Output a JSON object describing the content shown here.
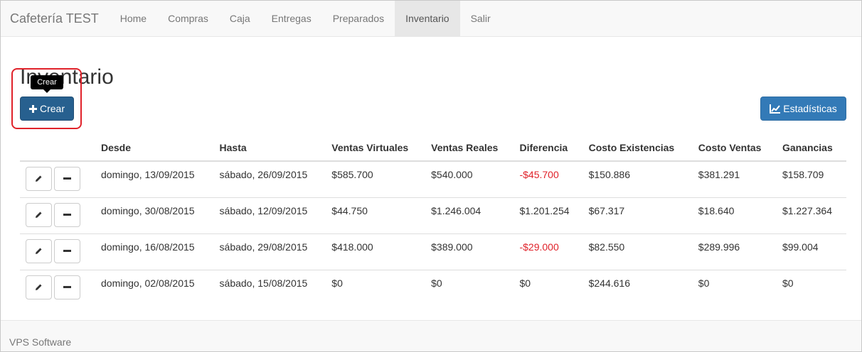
{
  "navbar": {
    "brand": "Cafetería TEST",
    "items": [
      {
        "label": "Home",
        "active": false
      },
      {
        "label": "Compras",
        "active": false
      },
      {
        "label": "Caja",
        "active": false
      },
      {
        "label": "Entregas",
        "active": false
      },
      {
        "label": "Preparados",
        "active": false
      },
      {
        "label": "Inventario",
        "active": true
      },
      {
        "label": "Salir",
        "active": false
      }
    ]
  },
  "page": {
    "title": "Inventario",
    "create_label": "Crear",
    "create_tooltip": "Crear",
    "stats_label": "Estadísticas",
    "create_icon": "plus-icon",
    "stats_icon": "line-chart-icon"
  },
  "colors": {
    "negative": "#e0222a",
    "primary": "#337ab7",
    "highlight": "#e0222a"
  },
  "table": {
    "headers": [
      "",
      "Desde",
      "Hasta",
      "Ventas Virtuales",
      "Ventas Reales",
      "Diferencia",
      "Costo Existencias",
      "Costo Ventas",
      "Ganancias"
    ],
    "row_actions": [
      "pencil-icon",
      "minus-icon"
    ],
    "rows": [
      {
        "desde": "domingo, 13/09/2015",
        "hasta": "sábado, 26/09/2015",
        "virtuales": "$585.700",
        "reales": "$540.000",
        "diferencia": "-$45.700",
        "neg": true,
        "existencias": "$150.886",
        "costo_ventas": "$381.291",
        "ganancias": "$158.709"
      },
      {
        "desde": "domingo, 30/08/2015",
        "hasta": "sábado, 12/09/2015",
        "virtuales": "$44.750",
        "reales": "$1.246.004",
        "diferencia": "$1.201.254",
        "neg": false,
        "existencias": "$67.317",
        "costo_ventas": "$18.640",
        "ganancias": "$1.227.364"
      },
      {
        "desde": "domingo, 16/08/2015",
        "hasta": "sábado, 29/08/2015",
        "virtuales": "$418.000",
        "reales": "$389.000",
        "diferencia": "-$29.000",
        "neg": true,
        "existencias": "$82.550",
        "costo_ventas": "$289.996",
        "ganancias": "$99.004"
      },
      {
        "desde": "domingo, 02/08/2015",
        "hasta": "sábado, 15/08/2015",
        "virtuales": "$0",
        "reales": "$0",
        "diferencia": "$0",
        "neg": false,
        "existencias": "$244.616",
        "costo_ventas": "$0",
        "ganancias": "$0"
      }
    ]
  },
  "footer": {
    "text": "VPS Software"
  }
}
